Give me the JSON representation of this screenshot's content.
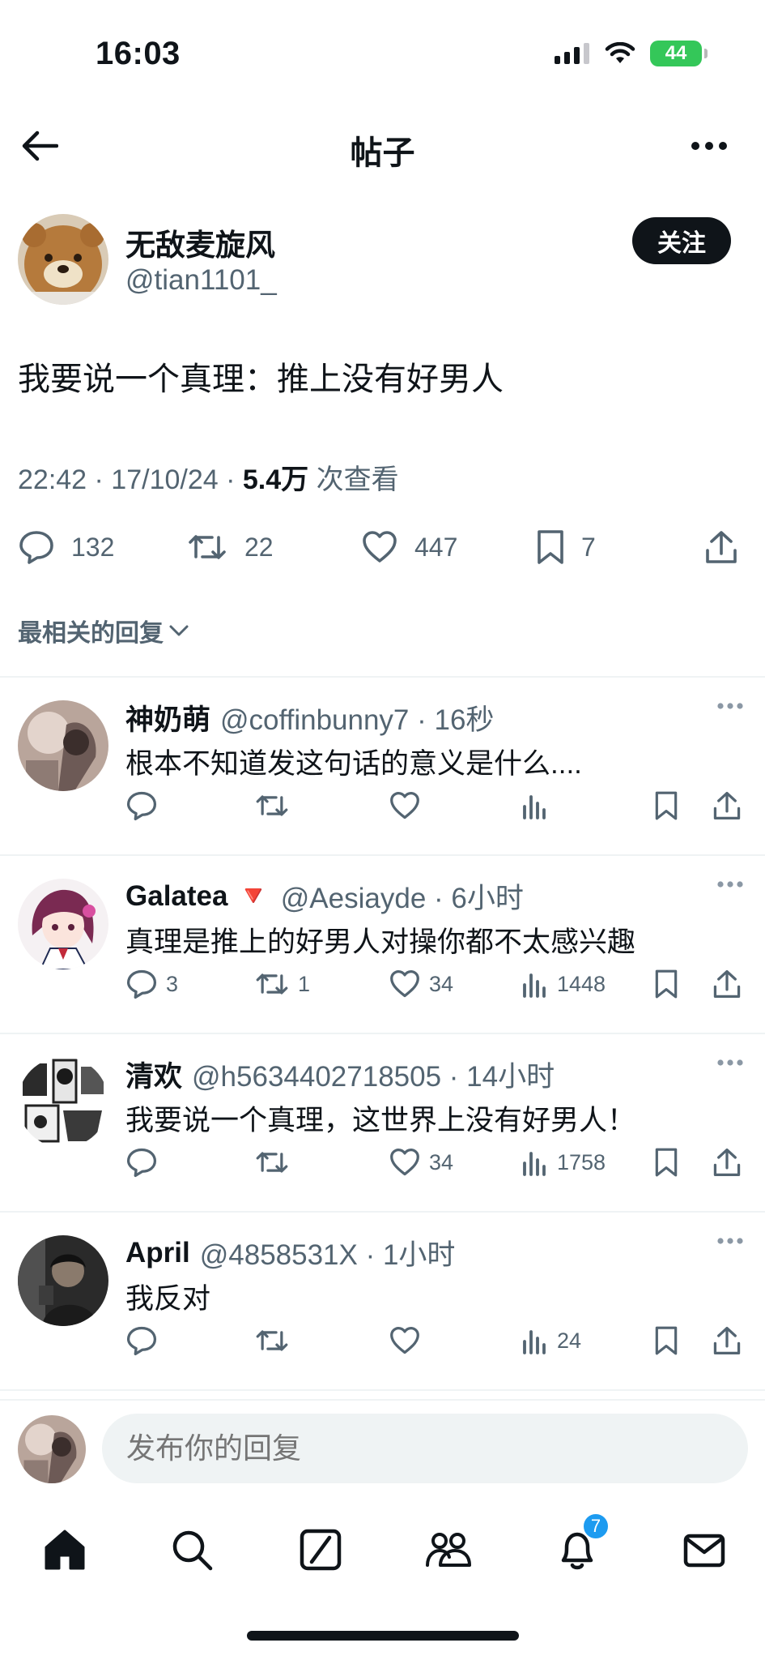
{
  "status_bar": {
    "time": "16:03",
    "battery": "44"
  },
  "header": {
    "title": "帖子"
  },
  "post": {
    "author_name": "无敌麦旋风",
    "author_handle": "@tian1101_",
    "follow_label": "关注",
    "text": "我要说一个真理：推上没有好男人",
    "time": "22:42 · 17/10/24 · ",
    "views": "5.4万",
    "views_suffix": " 次查看",
    "replies": "132",
    "reposts": "22",
    "likes": "447",
    "bookmarks": "7"
  },
  "sort": {
    "label": "最相关的回复"
  },
  "replies": [
    {
      "name": "神奶萌",
      "handle": "@coffinbunny7 · 16秒",
      "text": "根本不知道发这句话的意义是什么....",
      "replies": "",
      "reposts": "",
      "likes": "",
      "views": ""
    },
    {
      "name": "Galatea 🔻",
      "handle": "@Aesiayde · 6小时",
      "text": "真理是推上的好男人对操你都不太感兴趣",
      "replies": "3",
      "reposts": "1",
      "likes": "34",
      "views": "1448"
    },
    {
      "name": "清欢",
      "handle": "@h5634402718505 · 14小时",
      "text": "我要说一个真理，这世界上没有好男人！",
      "replies": "",
      "reposts": "",
      "likes": "34",
      "views": "1758"
    },
    {
      "name": "April",
      "handle": "@4858531X · 1小时",
      "text": "我反对",
      "replies": "",
      "reposts": "",
      "likes": "",
      "views": "24"
    }
  ],
  "composer": {
    "placeholder": "发布你的回复"
  },
  "tabbar": {
    "notifications_badge": "7"
  },
  "icons": [
    "back-arrow-icon",
    "more-icon",
    "reply-icon",
    "repost-icon",
    "like-icon",
    "bookmark-icon",
    "share-icon",
    "views-icon",
    "home-icon",
    "search-icon",
    "grok-icon",
    "communities-icon",
    "bell-icon",
    "mail-icon"
  ],
  "colors": {
    "accent": "#1d9bf0",
    "text": "#0f1419",
    "muted": "#536471",
    "battery": "#34c759"
  }
}
